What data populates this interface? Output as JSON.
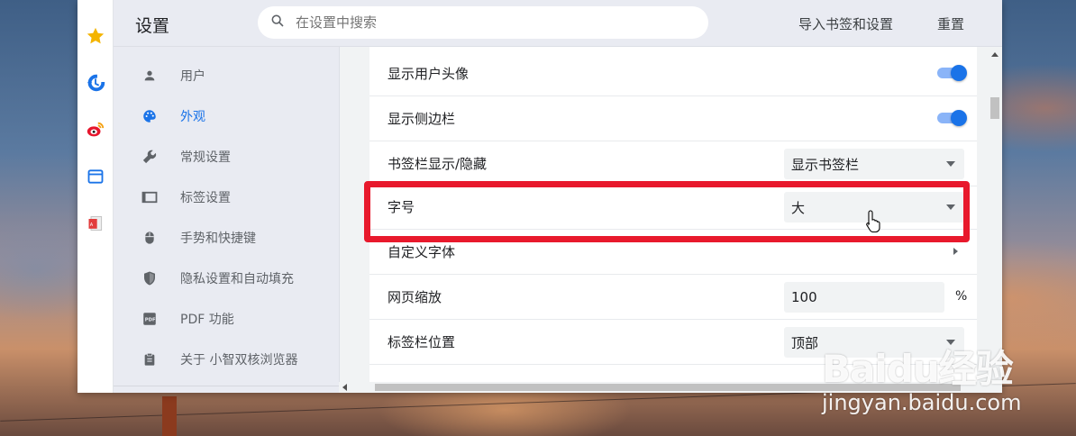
{
  "header": {
    "title": "设置",
    "search_placeholder": "在设置中搜索",
    "import_label": "导入书签和设置",
    "reset_label": "重置"
  },
  "iconbar": {
    "icons": [
      "star-icon",
      "history-icon",
      "weibo-icon",
      "window-icon",
      "pdf-document-icon"
    ]
  },
  "sidebar": {
    "items": [
      {
        "label": "用户",
        "icon": "person-icon",
        "active": false
      },
      {
        "label": "外观",
        "icon": "palette-icon",
        "active": true
      },
      {
        "label": "常规设置",
        "icon": "wrench-icon",
        "active": false
      },
      {
        "label": "标签设置",
        "icon": "tab-icon",
        "active": false
      },
      {
        "label": "手势和快捷键",
        "icon": "mouse-icon",
        "active": false
      },
      {
        "label": "隐私设置和自动填充",
        "icon": "shield-icon",
        "active": false
      },
      {
        "label": "PDF 功能",
        "icon": "pdf-icon",
        "active": false
      },
      {
        "label": "关于 小智双核浏览器",
        "icon": "clipboard-icon",
        "active": false
      }
    ]
  },
  "settings": {
    "show_avatar": {
      "label": "显示用户头像",
      "enabled": true
    },
    "show_sidebar": {
      "label": "显示侧边栏",
      "enabled": true
    },
    "bookmark_bar": {
      "label": "书签栏显示/隐藏",
      "value": "显示书签栏"
    },
    "font_size": {
      "label": "字号",
      "value": "大"
    },
    "custom_font": {
      "label": "自定义字体"
    },
    "page_zoom": {
      "label": "网页缩放",
      "value": "100",
      "unit": "%"
    },
    "tab_position": {
      "label": "标签栏位置",
      "value": "顶部"
    }
  },
  "colors": {
    "accent": "#1a73e8",
    "highlight_box": "#e8192c"
  },
  "watermark": {
    "logo": "Baidu经验",
    "url": "jingyan.baidu.com"
  }
}
